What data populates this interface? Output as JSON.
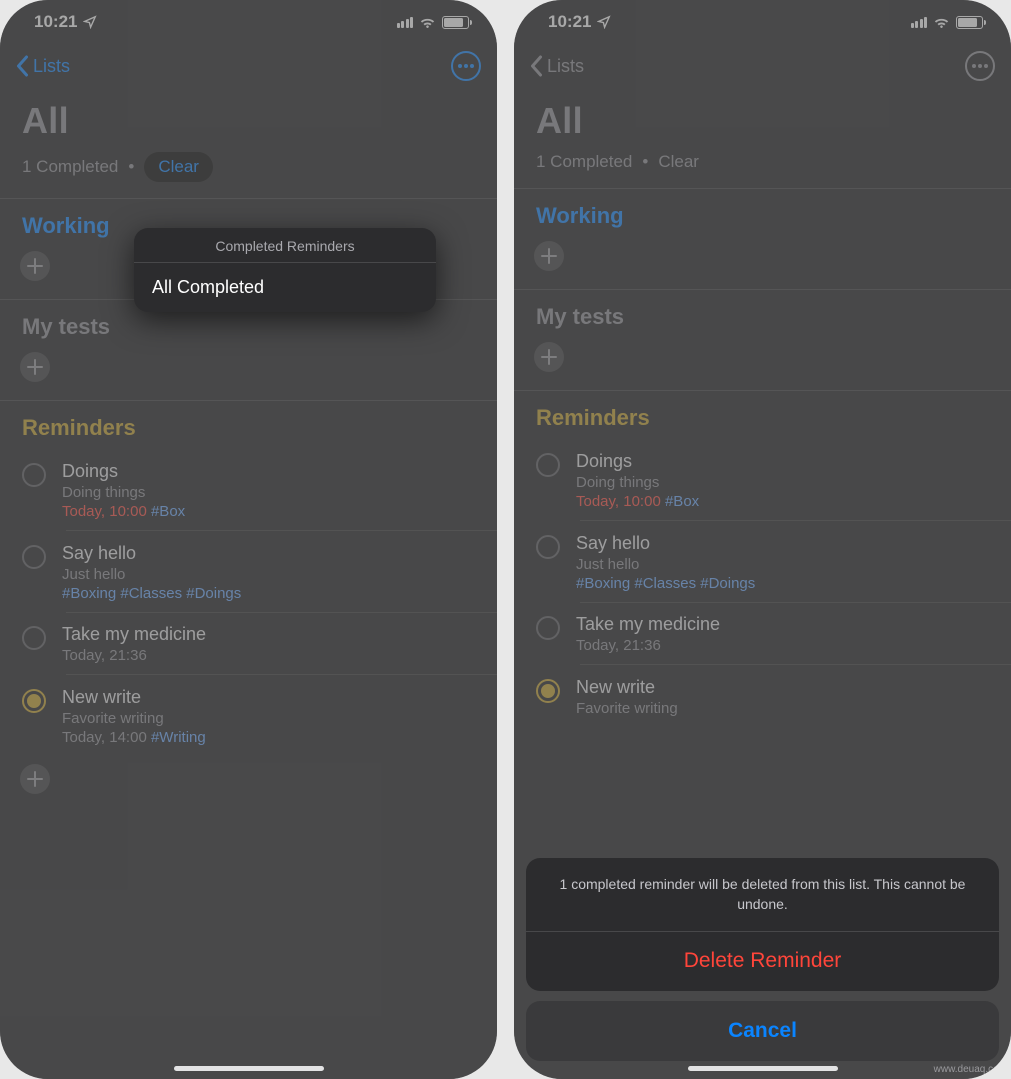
{
  "watermark": "www.deuaq.com",
  "statusbar": {
    "time": "10:21"
  },
  "nav": {
    "back_label": "Lists"
  },
  "header": {
    "title": "All",
    "completed_count_label": "1 Completed",
    "clear_label": "Clear"
  },
  "sections": {
    "working": {
      "title": "Working"
    },
    "mytests": {
      "title": "My tests"
    },
    "reminders": {
      "title": "Reminders",
      "items": [
        {
          "title": "Doings",
          "sub": "Doing things",
          "meta_time": "Today, 10:00",
          "meta_tag": "#Box",
          "done": false,
          "meta_time_color": "red"
        },
        {
          "title": "Say hello",
          "sub": "Just hello",
          "meta_tags": "#Boxing #Classes #Doings",
          "done": false
        },
        {
          "title": "Take my medicine",
          "sub": "",
          "meta_time": "Today, 21:36",
          "done": false,
          "meta_time_color": "gray"
        },
        {
          "title": "New write",
          "sub": "Favorite writing",
          "meta_time": "Today, 14:00",
          "meta_tag": "#Writing",
          "done": true,
          "meta_time_color": "gray"
        }
      ]
    }
  },
  "popover": {
    "header": "Completed Reminders",
    "items": [
      "All Completed"
    ]
  },
  "actionsheet": {
    "message": "1 completed reminder will be deleted from this list. This cannot be undone.",
    "destructive": "Delete Reminder",
    "cancel": "Cancel"
  }
}
